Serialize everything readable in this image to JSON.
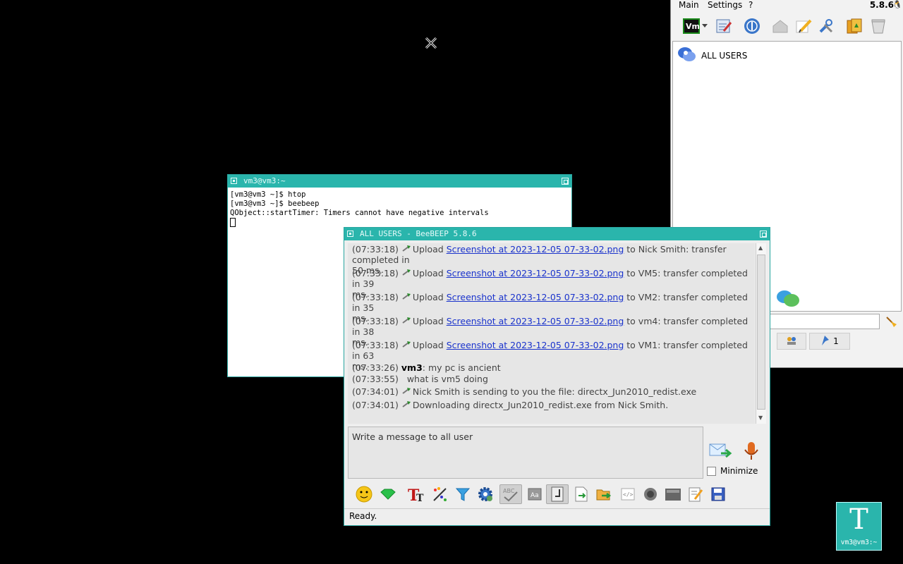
{
  "main_window": {
    "menu": [
      "Main",
      "Settings",
      "?"
    ],
    "version": "5.8.6",
    "all_users_label": "ALL USERS",
    "user_count_badge": "1",
    "toolbar_icons": [
      "vm-status-icon",
      "dropdown-icon",
      "edit-profile-icon",
      "network-icon",
      "home-icon",
      "note-icon",
      "tools-icon",
      "group-icon",
      "trash-icon"
    ]
  },
  "terminal": {
    "title": "vm3@vm3:~",
    "lines": [
      "[vm3@vm3 ~]$ htop",
      "[vm3@vm3 ~]$ beebeep",
      "QObject::startTimer: Timers cannot have negative intervals"
    ]
  },
  "chat": {
    "title": "ALL USERS - BeeBEEP 5.8.6",
    "uploads": [
      {
        "time": "(07:33:18)",
        "verb": "Upload",
        "file": "Screenshot at 2023-12-05 07-33-02.png",
        "rest": "to Nick Smith: transfer completed in",
        "rest2": "50 ms."
      },
      {
        "time": "(07:33:18)",
        "verb": "Upload",
        "file": "Screenshot at 2023-12-05 07-33-02.png",
        "rest": "to VM5: transfer completed in 39",
        "rest2": "ms."
      },
      {
        "time": "(07:33:18)",
        "verb": "Upload",
        "file": "Screenshot at 2023-12-05 07-33-02.png",
        "rest": "to VM2: transfer completed in 35",
        "rest2": "ms."
      },
      {
        "time": "(07:33:18)",
        "verb": "Upload",
        "file": "Screenshot at 2023-12-05 07-33-02.png",
        "rest": "to vm4: transfer completed in 38",
        "rest2": "ms."
      },
      {
        "time": "(07:33:18)",
        "verb": "Upload",
        "file": "Screenshot at 2023-12-05 07-33-02.png",
        "rest": "to VM1: transfer completed in 63",
        "rest2": "ms."
      }
    ],
    "messages": [
      {
        "time": "(07:33:26)",
        "user": "vm3",
        "text": ": my pc is ancient"
      },
      {
        "time": "(07:33:55)",
        "text": "what is vm5 doing"
      },
      {
        "time": "(07:34:01)",
        "text": "Nick Smith is sending to you the file: directx_Jun2010_redist.exe"
      },
      {
        "time": "(07:34:01)",
        "text": "Downloading directx_Jun2010_redist.exe from Nick Smith."
      }
    ],
    "input_placeholder": "Write a message to all user",
    "minimize_label": "Minimize",
    "status": "Ready."
  },
  "desktop": {
    "terminal_icon_label": "vm3@vm3:~"
  }
}
